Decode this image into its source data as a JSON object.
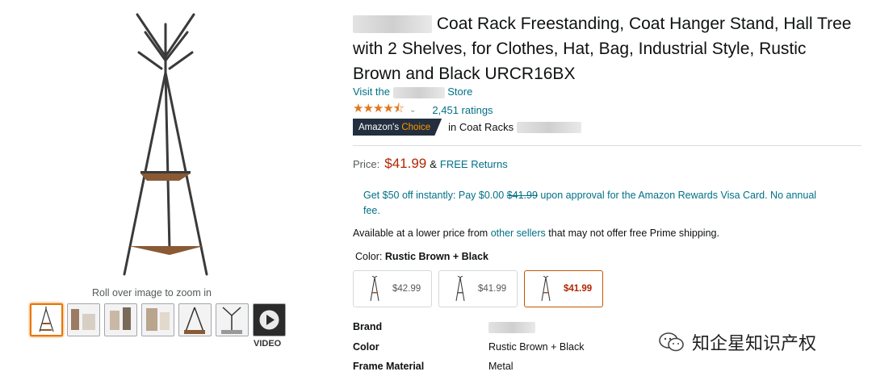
{
  "gallery": {
    "zoom_hint": "Roll over image to zoom in",
    "video_label": "VIDEO",
    "thumbnail_count": 7
  },
  "product": {
    "title_suffix": "Coat Rack Freestanding, Coat Hanger Stand, Hall Tree with 2 Shelves, for Clothes, Hat, Bag, Industrial Style, Rustic Brown and Black URCR16BX",
    "store_prefix": "Visit the",
    "store_suffix": "Store",
    "rating_stars": 4.5,
    "rating_count": "2,451 ratings",
    "choice_badge_main": "Amazon's",
    "choice_badge_accent": "Choice",
    "choice_category_prefix": "in Coat Racks"
  },
  "pricing": {
    "label": "Price:",
    "price": "$41.99",
    "amp": "&",
    "free_returns": "FREE Returns",
    "promo_prefix": "Get $50 off instantly: Pay $0.00",
    "promo_strike": "$41.99",
    "promo_suffix": "upon approval for the Amazon Rewards Visa Card. No annual fee.",
    "lower_price_prefix": "Available at a lower price from",
    "lower_price_link": "other sellers",
    "lower_price_suffix": "that may not offer free Prime shipping."
  },
  "variants": {
    "color_label": "Color:",
    "color_value": "Rustic Brown + Black",
    "options": [
      {
        "price": "$42.99"
      },
      {
        "price": "$41.99"
      },
      {
        "price": "$41.99"
      }
    ]
  },
  "specs": [
    {
      "key": "Brand",
      "value": ""
    },
    {
      "key": "Color",
      "value": "Rustic Brown + Black"
    },
    {
      "key": "Frame Material",
      "value": "Metal"
    }
  ],
  "watermark": {
    "text": "知企星知识产权"
  },
  "colors": {
    "link": "#007185",
    "price": "#b12704",
    "star": "#de7921",
    "badge_bg": "#232f3e",
    "badge_accent": "#ff9900",
    "selected_border": "#e77600"
  }
}
